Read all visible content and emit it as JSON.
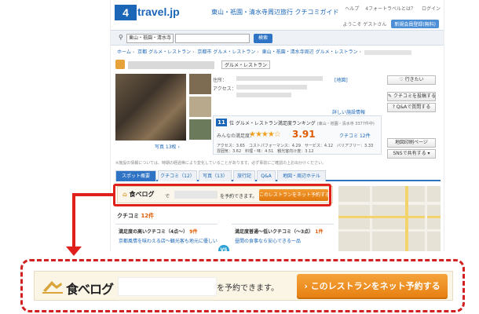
{
  "header": {
    "logo_mark": "4",
    "logo_text": "travel.jp",
    "site_subtitle": "東山・祇園・清水寺周辺旅行 クチコミガイド",
    "top_links": [
      "ヘルプ",
      "4フォートラベルとは？",
      "ログイン"
    ],
    "welcome": "ようこそ ゲストさん",
    "register_label": "新規会員登録(無料)"
  },
  "search": {
    "area_value": "東山・祇園・清水寺",
    "placeholder": "",
    "button_label": "検索"
  },
  "breadcrumb": [
    "ホーム",
    "京都 グルメ・レストラン",
    "京都市 グルメ・レストラン",
    "東山・祇園・清水寺周辺 グルメ・レストラン"
  ],
  "restaurant": {
    "category_tag": "グルメ・レストラン",
    "address_label": "住所：",
    "access_label": "アクセス：",
    "map_link": "[地図]",
    "more_info_link": "詳しい施設情報",
    "photo_caption": "写真 13枚 ›"
  },
  "rating": {
    "rank": "11",
    "rank_text": "位 グルメ・レストラン満足度ランキング",
    "rank_scope": "(東山・祇園・清水寺 3377件中)",
    "satisfaction_label": "みんなの満足度：",
    "stars": "★★★★☆",
    "score": "3.91",
    "reviews": "クチコミ",
    "review_count": "12件",
    "subscores_line1": "アクセス：3.65　コストパフォーマンス：4.29　サービス：4.12　バリアフリー：3.33",
    "subscores_line2": "雰囲気：3.62　料理・味：4.51　観光客向け度：3.12"
  },
  "side_buttons": [
    "行きたい",
    "クチコミを投稿する",
    "Q&Aで質問する",
    "地図印刷ページ",
    "SNSで共有する"
  ],
  "notice": "※施設の情報については、時期の経過等により変化していることがあります。必ず事前にご確認の上お出かけください。",
  "tabs": [
    "スポット概要",
    "クチコミ（12）",
    "写真（13）",
    "旅行記",
    "Q&A",
    "地図・周辺ホテル"
  ],
  "tabelog": {
    "logo": "食べログ",
    "de": "で",
    "reserve_text": "を予約できます。",
    "button_label": "このレストランをネット予約する"
  },
  "reviews": {
    "heading": "クチコミ",
    "count": "12件",
    "high_title": "満足度の高いクチコミ（4点～）",
    "high_count": "9件",
    "low_title": "満足度普通～低いクチコミ（～3点）",
    "low_count": "1件",
    "high_link": "京都風情を味わえる店～観光客も地元に優しい",
    "low_link": "昼間の食事なら安心できる一品",
    "vs": "VS"
  },
  "callout": {
    "logo": "食べログ",
    "reserve_text": "を予約できます。",
    "button_label": "このレストランをネット予約する"
  },
  "colors": {
    "brand_blue": "#1b66b7",
    "highlight_red": "#e0201a",
    "button_orange": "#e67e10",
    "score_orange": "#e05a00"
  }
}
